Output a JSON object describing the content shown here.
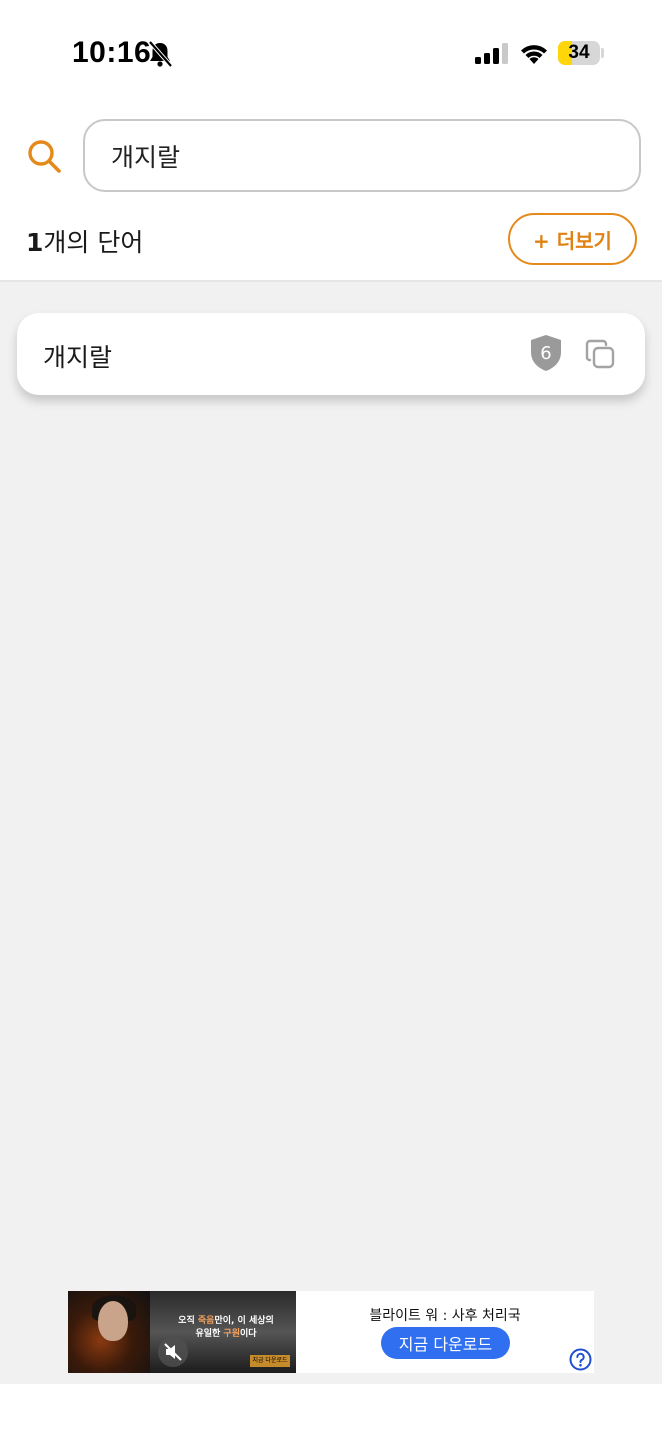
{
  "status_bar": {
    "time": "10:16",
    "battery_percent": 34,
    "battery_label": "34"
  },
  "search": {
    "query": "개지랄"
  },
  "results_header": {
    "count": "1",
    "count_suffix": "개의 단어",
    "more_label": "+ 더보기"
  },
  "results": [
    {
      "word": "개지랄",
      "level": "6"
    }
  ],
  "ad": {
    "headline_pre": "오직 ",
    "headline_accent1": "죽음",
    "headline_mid": "만이, 이 세상의",
    "headline_line2_pre": "유일한 ",
    "headline_accent2": "구원",
    "headline_line2_post": "이다",
    "mini_badge": "지금 다운로드",
    "title": "블라이트 워 : 사후 처리국",
    "cta": "지금 다운로드"
  },
  "colors": {
    "accent": "#e58a1a",
    "background": "#f1f1f1",
    "ad_button": "#2f6ff0",
    "battery": "#ffd60a"
  },
  "icons": [
    "bell-slash-icon",
    "signal-icon",
    "wifi-icon",
    "search-icon",
    "shield-icon",
    "copy-icon",
    "mute-icon",
    "help-icon"
  ]
}
